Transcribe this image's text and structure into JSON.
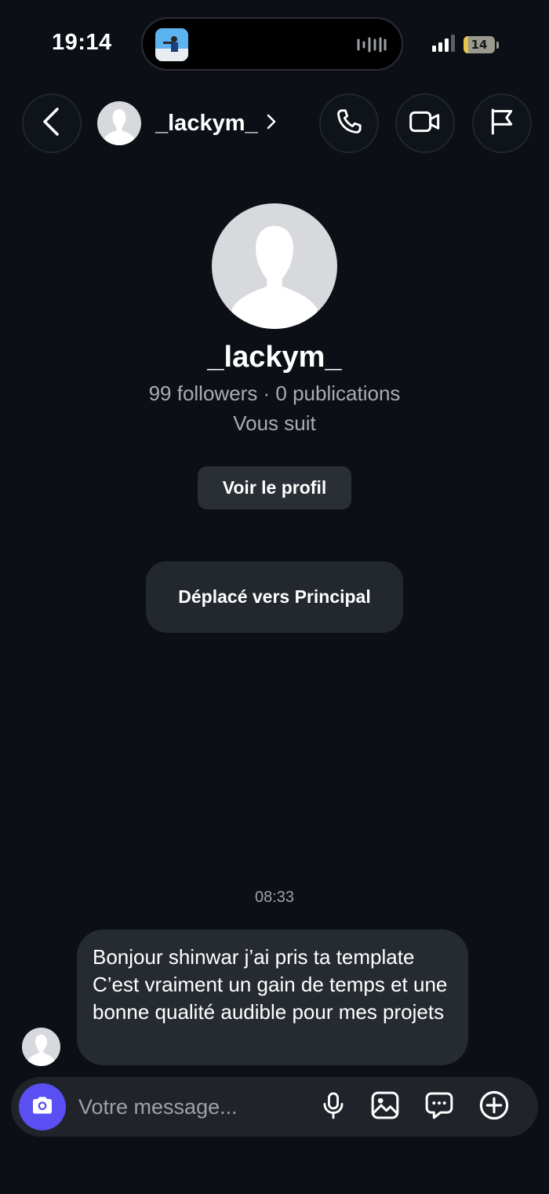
{
  "status_bar": {
    "time": "19:14",
    "battery": "14",
    "battery_fraction": 0.14,
    "icons": [
      "island-thumbnail",
      "audio-waveform-icon",
      "signal-icon",
      "battery-icon"
    ]
  },
  "header": {
    "username": "_lackym_",
    "icons": [
      "back-arrow-icon",
      "avatar",
      "chevron-right-icon",
      "phone-icon",
      "video-camera-icon",
      "flag-icon"
    ]
  },
  "profile": {
    "username": "_lackym_",
    "stats": "99 followers · 0 publications",
    "follow_status": "Vous suit",
    "view_profile_label": "Voir le profil"
  },
  "notice": "Déplacé vers Principal",
  "conversation": {
    "timestamp": "08:33",
    "messages": [
      {
        "from": "_lackym_",
        "text": "Bonjour shinwar j’ai pris ta template C’est vraiment un gain de temps et une bonne qualité audible pour mes projets"
      }
    ]
  },
  "composer": {
    "placeholder": "Votre message...",
    "icons": [
      "camera-icon",
      "microphone-icon",
      "image-icon",
      "sticker-chat-icon",
      "add-circle-icon"
    ]
  },
  "colors": {
    "background": "#0c1016",
    "bubble": "#262a31",
    "accent": "#5a4ff2",
    "secondary_text": "#a8adb4"
  }
}
